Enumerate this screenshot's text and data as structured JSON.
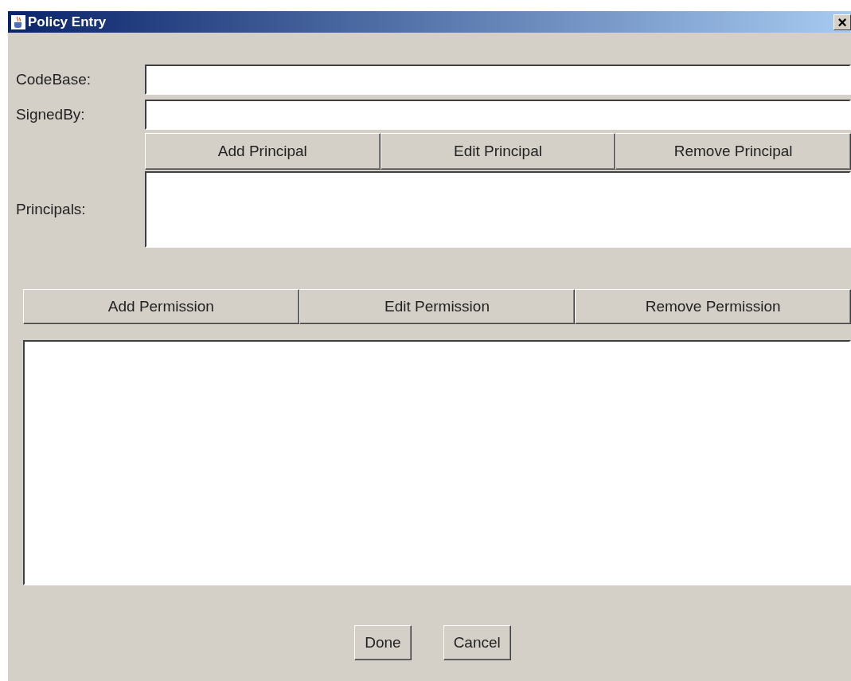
{
  "window": {
    "title": "Policy Entry",
    "close": "×"
  },
  "fields": [
    {
      "label": "CodeBase:"
    },
    {
      "label": "SignedBy:"
    }
  ],
  "principal_buttons": [
    "Add Principal",
    "Edit Principal",
    "Remove Principal"
  ],
  "principals": {
    "label": "Principals:"
  },
  "permission_buttons": [
    "Add Permission",
    "Edit Permission",
    "Remove Permission"
  ],
  "buttons": [
    "Done",
    "Cancel"
  ]
}
